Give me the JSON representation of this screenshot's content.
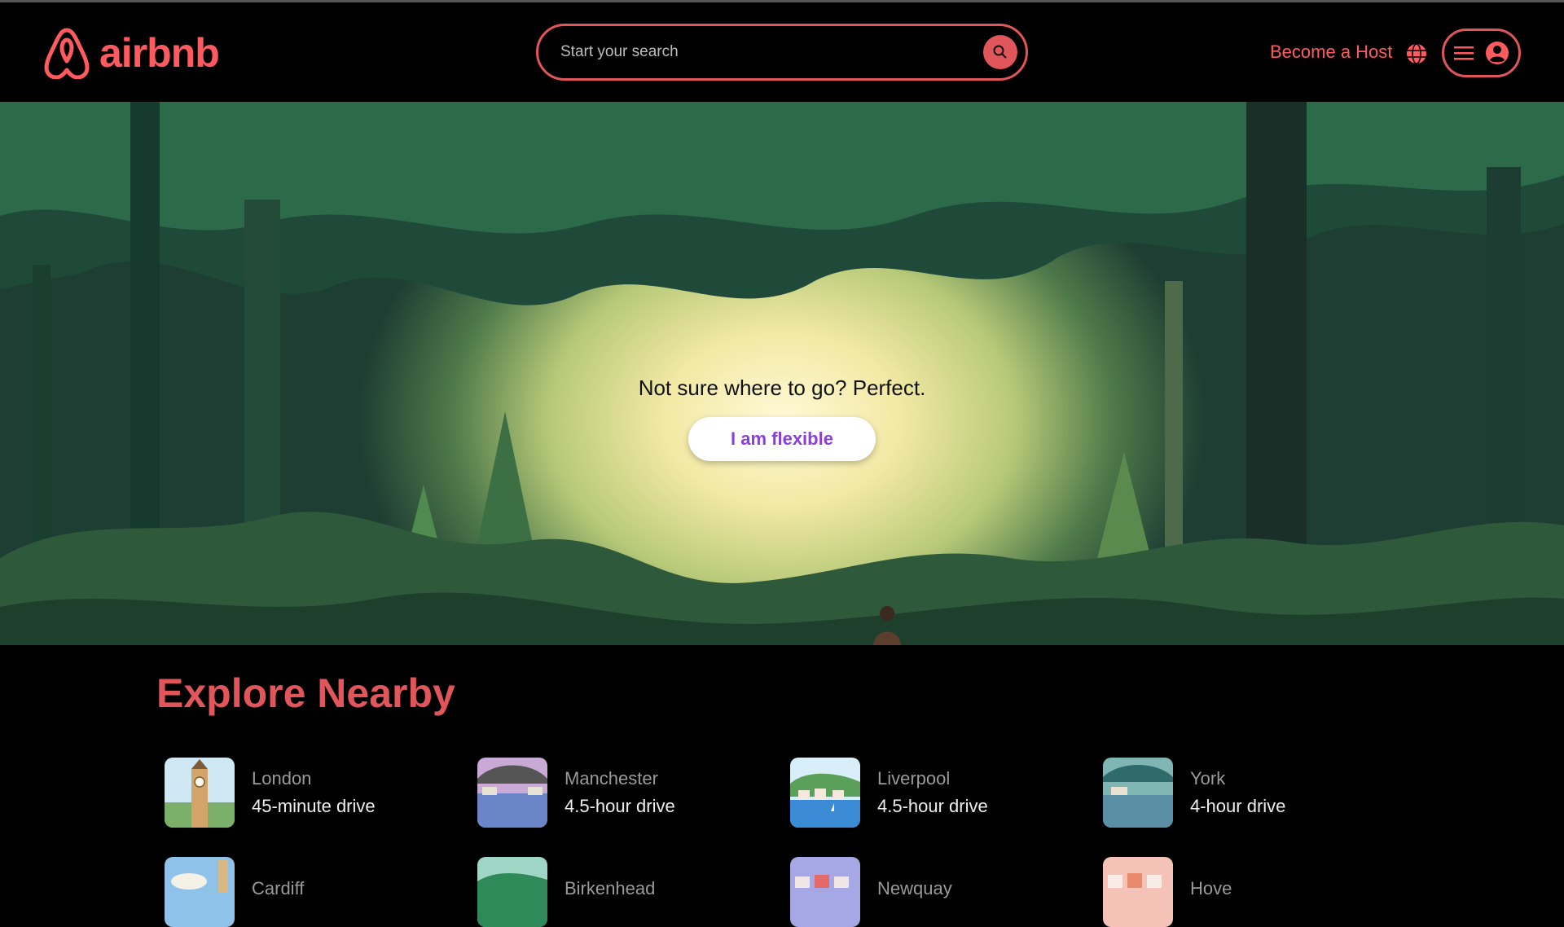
{
  "header": {
    "logo_text": "airbnb",
    "search_placeholder": "Start your search",
    "become_host": "Become a Host",
    "icons": [
      "airbnb-logo-icon",
      "search-icon",
      "globe-icon",
      "hamburger-menu-icon",
      "user-avatar-icon"
    ]
  },
  "hero": {
    "tagline": "Not sure where to go? Perfect.",
    "cta": "I am flexible"
  },
  "explore": {
    "title": "Explore Nearby",
    "destinations": [
      {
        "city": "London",
        "drive": "45-minute drive"
      },
      {
        "city": "Manchester",
        "drive": "4.5-hour drive"
      },
      {
        "city": "Liverpool",
        "drive": "4.5-hour drive"
      },
      {
        "city": "York",
        "drive": "4-hour drive"
      },
      {
        "city": "Cardiff",
        "drive": ""
      },
      {
        "city": "Birkenhead",
        "drive": ""
      },
      {
        "city": "Newquay",
        "drive": ""
      },
      {
        "city": "Hove",
        "drive": ""
      }
    ]
  },
  "colors": {
    "brand": "#ff5a5f",
    "brand_border": "#e0565b",
    "cta_text": "#8b3fd9",
    "background": "#000000"
  }
}
